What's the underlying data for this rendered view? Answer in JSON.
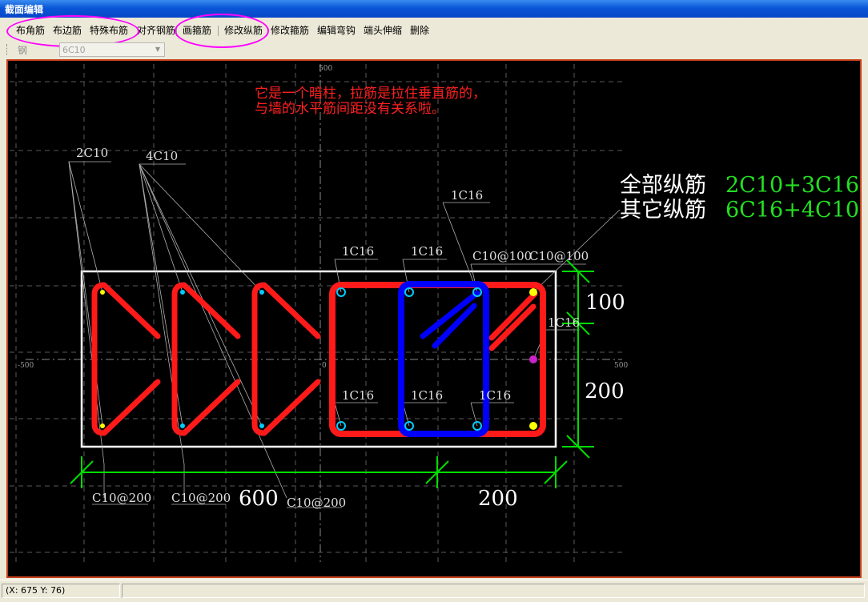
{
  "window": {
    "title": "截面编辑"
  },
  "toolbar": {
    "corner_rebar": "布角筋",
    "edge_rebar": "布边筋",
    "special_rebar": "特殊布筋",
    "align_rebar": "对齐钢筋",
    "draw_stirrup": "画箍筋",
    "edit_longitudinal": "修改纵筋",
    "edit_stirrup": "修改箍筋",
    "edit_hook": "编辑弯钩",
    "end_extension": "端头伸缩",
    "delete": "删除"
  },
  "rebar_info": {
    "label": "钢筋信息",
    "value": "6C10"
  },
  "drawing": {
    "note_line1": "它是一个暗柱，拉筋是拉住垂直筋的，",
    "note_line2": "与墙的水平筋间距没有关系啦。",
    "all_long_label": "全部纵筋",
    "all_long_value": "2C10+3C16",
    "other_long_label": "其它纵筋",
    "other_long_value": "6C16+4C10",
    "tick_500_top": "500",
    "tick_neg500": "-500",
    "tick_0": "0",
    "tick_500_right": "500",
    "label_2c10": "2C10",
    "label_4c10": "4C10",
    "label_1c16_a": "1C16",
    "label_1c16_b": "1C16",
    "label_1c16_c": "1C16",
    "label_1c16_d": "1C16",
    "label_1c16_e": "1C16",
    "label_1c16_f": "1C16",
    "label_1c16_g": "1C16",
    "label_c10_100a": "C10@100",
    "label_c10_100b": "C10@100",
    "label_c10_200a": "C10@200",
    "label_c10_200b": "C10@200",
    "label_c10_200c": "C10@200",
    "dim_600": "600",
    "dim_200_bottom": "200",
    "dim_100": "100",
    "dim_200_side": "200"
  },
  "colors": {
    "tie": "#FF1A1A",
    "blue_stirrup": "#0000FF",
    "dimension": "#00DD00",
    "note_text": "#FF2020",
    "highlight": "#FF00FF"
  },
  "status": {
    "coords": "(X: 675 Y: 76)"
  }
}
